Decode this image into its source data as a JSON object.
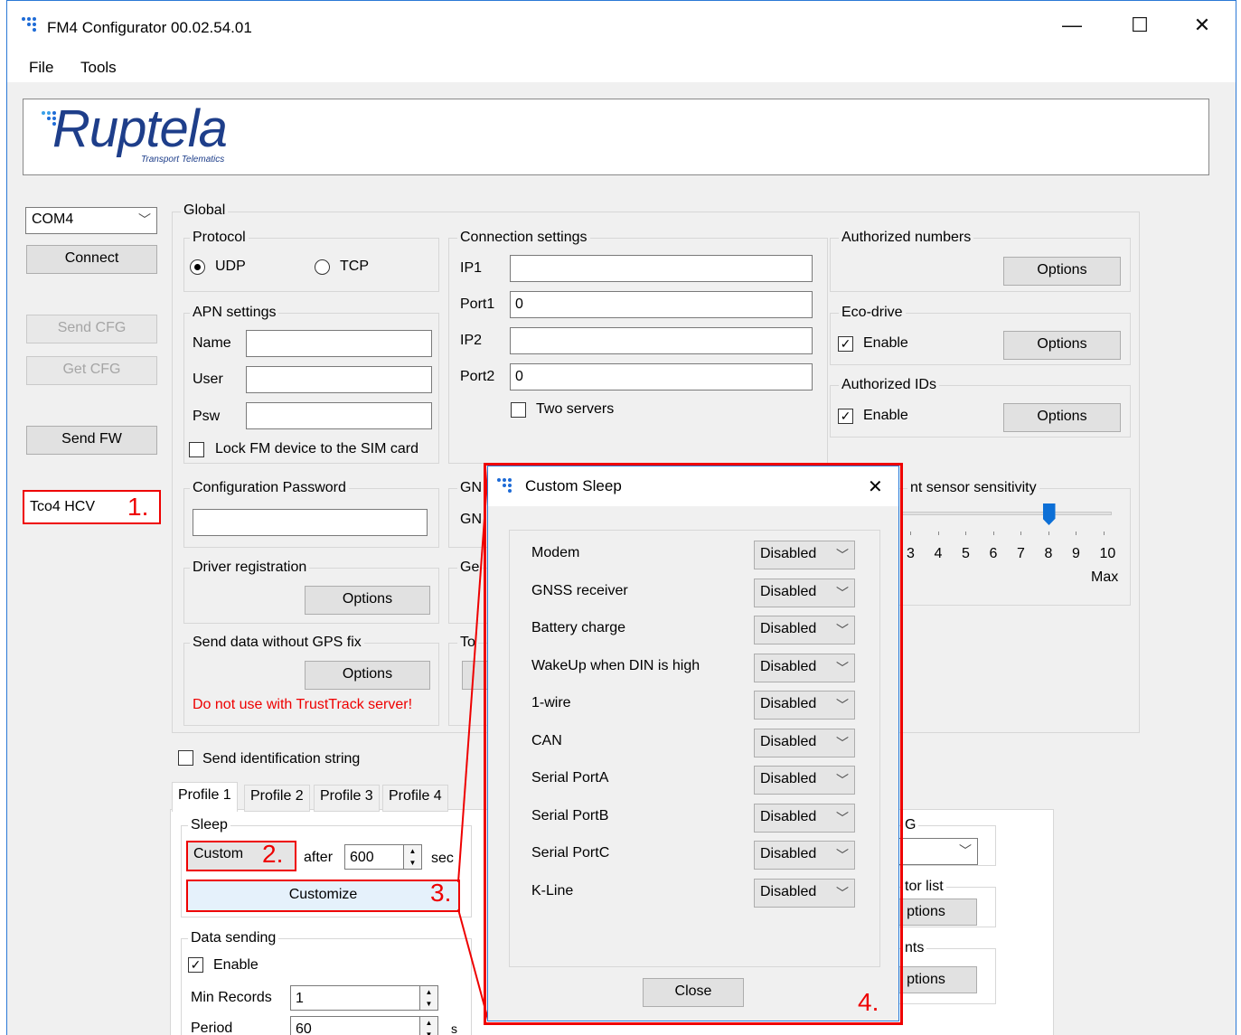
{
  "window": {
    "title": "FM4 Configurator 00.02.54.01",
    "minimize": "—",
    "maximize": "☐",
    "close": "✕"
  },
  "menu": {
    "file": "File",
    "tools": "Tools"
  },
  "logo": {
    "text": "Ruptela",
    "subtitle": "Transport Telematics"
  },
  "left": {
    "com_port": "COM4",
    "connect": "Connect",
    "send_cfg": "Send CFG",
    "get_cfg": "Get CFG",
    "send_fw": "Send FW",
    "device": "Tco4 HCV"
  },
  "global": {
    "label": "Global",
    "protocol": {
      "label": "Protocol",
      "udp": "UDP",
      "tcp": "TCP"
    },
    "apn": {
      "label": "APN settings",
      "name": "Name",
      "user": "User",
      "psw": "Psw",
      "lock": "Lock FM device to the SIM card"
    },
    "config_password": {
      "label": "Configuration Password"
    },
    "driver_registration": {
      "label": "Driver registration",
      "options": "Options"
    },
    "send_without_gps": {
      "label": "Send data without GPS fix",
      "options": "Options",
      "warning": "Do not use with TrustTrack server!"
    },
    "connection": {
      "label": "Connection settings",
      "ip1": "IP1",
      "port1": "Port1",
      "port1_value": "0",
      "ip2": "IP2",
      "port2": "Port2",
      "port2_value": "0",
      "two_servers": "Two servers"
    },
    "gn_cut": "GN",
    "gn_cut2": "GN",
    "ge_cut": "Ge",
    "to_cut": "To",
    "authorized_numbers": {
      "label": "Authorized numbers",
      "options": "Options"
    },
    "eco_drive": {
      "label": "Eco-drive",
      "enable": "Enable",
      "options": "Options"
    },
    "authorized_ids": {
      "label": "Authorized IDs",
      "enable": "Enable",
      "options": "Options"
    },
    "sensitivity": {
      "label": "nt sensor sensitivity",
      "ticks": [
        "3",
        "4",
        "5",
        "6",
        "7",
        "8",
        "9",
        "10"
      ],
      "max": "Max",
      "value": 8
    }
  },
  "send_identification": "Send identification string",
  "profiles": {
    "tabs": [
      "Profile 1",
      "Profile 2",
      "Profile 3",
      "Profile 4"
    ],
    "sleep": {
      "label": "Sleep",
      "mode": "Custom",
      "after": "after",
      "after_value": "600",
      "unit": "sec",
      "customize": "Customize"
    },
    "data_sending": {
      "label": "Data sending",
      "enable": "Enable",
      "min_records": "Min Records",
      "min_records_value": "1",
      "period": "Period",
      "period_value": "60",
      "period_unit": "s"
    },
    "right_cut": {
      "g_label": "G",
      "list_label": "tor list",
      "options1": "ptions",
      "events_label": "nts",
      "options2": "ptions"
    }
  },
  "annotations": {
    "n1": "1.",
    "n2": "2.",
    "n3": "3.",
    "n4": "4."
  },
  "dialog": {
    "title": "Custom Sleep",
    "close_x": "✕",
    "close": "Close",
    "rows": [
      {
        "label": "Modem",
        "value": "Disabled"
      },
      {
        "label": "GNSS receiver",
        "value": "Disabled"
      },
      {
        "label": "Battery charge",
        "value": "Disabled"
      },
      {
        "label": "WakeUp when DIN is high",
        "value": "Disabled"
      },
      {
        "label": "1-wire",
        "value": "Disabled"
      },
      {
        "label": "CAN",
        "value": "Disabled"
      },
      {
        "label": "Serial PortA",
        "value": "Disabled"
      },
      {
        "label": "Serial PortB",
        "value": "Disabled"
      },
      {
        "label": "Serial PortC",
        "value": "Disabled"
      },
      {
        "label": "K-Line",
        "value": "Disabled"
      }
    ]
  },
  "colors": {
    "accent": "#2b79d6",
    "annotation": "#e00000",
    "logo": "#1e3e8a"
  }
}
